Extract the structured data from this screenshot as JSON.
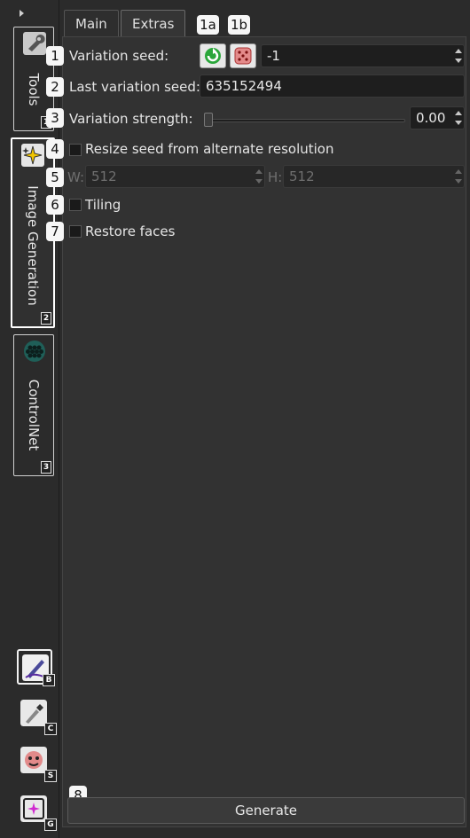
{
  "tabs": {
    "main": "Main",
    "extras": "Extras"
  },
  "side_tabs": [
    {
      "label": "Tools",
      "badge": "1",
      "icon": "wrench-icon"
    },
    {
      "label": "Image Generation",
      "badge": "2",
      "icon": "sparkle-icon"
    },
    {
      "label": "ControlNet",
      "badge": "3",
      "icon": "hex-grid-icon"
    }
  ],
  "tools": [
    {
      "badge": "B",
      "icon": "brush-icon"
    },
    {
      "badge": "C",
      "icon": "eyedropper-icon"
    },
    {
      "badge": "S",
      "icon": "face-icon"
    },
    {
      "badge": "G",
      "icon": "generate-icon"
    }
  ],
  "callouts": [
    "1",
    "2",
    "3",
    "4",
    "5",
    "6",
    "7",
    "8",
    "1a",
    "1b"
  ],
  "fields": {
    "variation_seed_label": "Variation seed:",
    "variation_seed_value": "-1",
    "last_variation_seed_label": "Last variation seed:",
    "last_variation_seed_value": "635152494",
    "variation_strength_label": "Variation strength:",
    "variation_strength_value": "0.00",
    "resize_seed_label": "Resize seed from alternate resolution",
    "w_label": "W:",
    "w_value": "512",
    "h_label": "H:",
    "h_value": "512",
    "tiling_label": "Tiling",
    "restore_faces_label": "Restore faces"
  },
  "generate_label": "Generate",
  "colors": {
    "refresh": "#2aa63a",
    "dice": "#e38a8a",
    "panel": "#323232"
  }
}
